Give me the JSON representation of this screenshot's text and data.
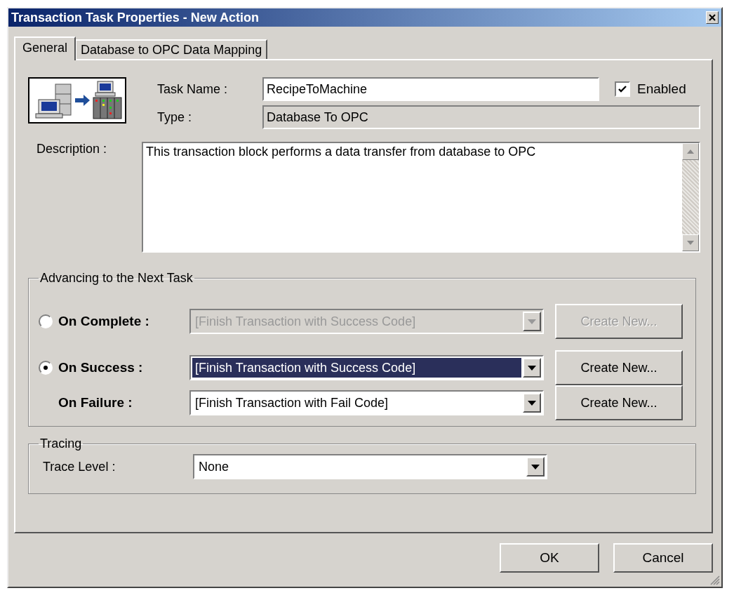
{
  "window": {
    "title": "Transaction Task Properties - New Action"
  },
  "tabs": [
    {
      "label": "General",
      "selected": true
    },
    {
      "label": "Database to OPC Data Mapping",
      "selected": false
    }
  ],
  "general": {
    "task_name": {
      "label": "Task Name :",
      "value": "RecipeToMachine"
    },
    "enabled": {
      "label": "Enabled",
      "checked": true
    },
    "type": {
      "label": "Type :",
      "value": "Database To OPC"
    },
    "description": {
      "label": "Description :",
      "value": "This transaction block performs a data transfer from database to OPC"
    }
  },
  "advancing": {
    "title": "Advancing to the Next Task",
    "rows": [
      {
        "kind": "radio",
        "label": "On Complete :",
        "selected": false,
        "disabled": true,
        "focused": false,
        "value": "[Finish Transaction with Success Code]",
        "button": "Create New..."
      },
      {
        "kind": "radio",
        "label": "On Success :",
        "selected": true,
        "disabled": false,
        "focused": true,
        "value": "[Finish Transaction with Success Code]",
        "button": "Create New..."
      },
      {
        "kind": "plain",
        "label": "On Failure :",
        "disabled": false,
        "focused": false,
        "value": "[Finish Transaction with Fail Code]",
        "button": "Create New..."
      }
    ]
  },
  "tracing": {
    "title": "Tracing",
    "trace_level": {
      "label": "Trace Level :",
      "value": "None"
    }
  },
  "buttons": [
    "OK",
    "Cancel"
  ]
}
